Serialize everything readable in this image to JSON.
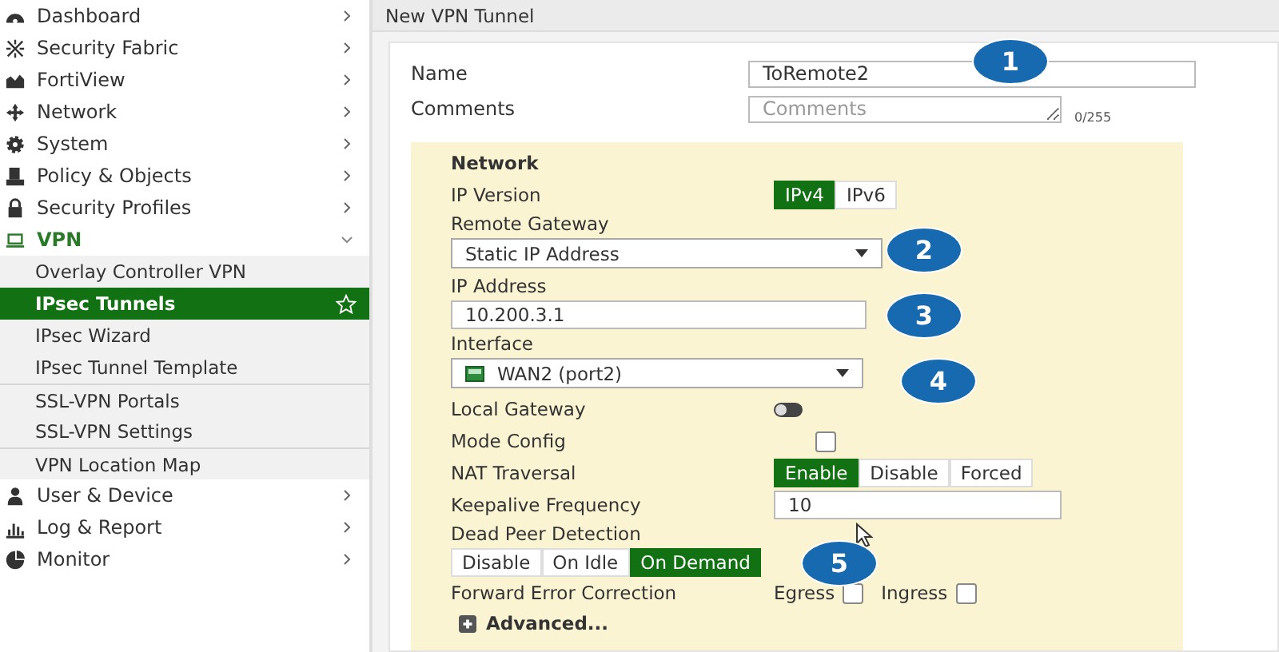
{
  "sidebar": {
    "items": [
      {
        "label": "Dashboard",
        "expanded": false
      },
      {
        "label": "Security Fabric",
        "expanded": false
      },
      {
        "label": "FortiView",
        "expanded": false
      },
      {
        "label": "Network",
        "expanded": false
      },
      {
        "label": "System",
        "expanded": false
      },
      {
        "label": "Policy & Objects",
        "expanded": false
      },
      {
        "label": "Security Profiles",
        "expanded": false
      },
      {
        "label": "VPN",
        "expanded": true,
        "children": [
          {
            "label": "Overlay Controller VPN",
            "selected": false
          },
          {
            "label": "IPsec Tunnels",
            "selected": true
          },
          {
            "label": "IPsec Wizard",
            "selected": false
          },
          {
            "label": "IPsec Tunnel Template",
            "selected": false
          },
          {
            "label": "SSL-VPN Portals",
            "selected": false
          },
          {
            "label": "SSL-VPN Settings",
            "selected": false
          },
          {
            "label": "VPN Location Map",
            "selected": false
          }
        ]
      },
      {
        "label": "User & Device",
        "expanded": false
      },
      {
        "label": "Log & Report",
        "expanded": false
      },
      {
        "label": "Monitor",
        "expanded": false
      }
    ]
  },
  "page_title": "New VPN Tunnel",
  "name": {
    "label": "Name",
    "value": "ToRemote2"
  },
  "comments": {
    "label": "Comments",
    "placeholder": "Comments",
    "counter": "0/255"
  },
  "network": {
    "heading": "Network",
    "rows": [
      {
        "kind": "segmented",
        "label": "IP Version",
        "options": [
          {
            "label": "IPv4",
            "selected": true
          },
          {
            "label": "IPv6",
            "selected": false
          }
        ]
      },
      {
        "kind": "select",
        "label": "Remote Gateway",
        "value": "Static IP Address"
      },
      {
        "kind": "text",
        "label": "IP Address",
        "value": "10.200.3.1"
      },
      {
        "kind": "select",
        "label": "Interface",
        "value": "WAN2 (port2)"
      },
      {
        "kind": "switch",
        "label": "Local Gateway",
        "on": false
      },
      {
        "kind": "checkbox",
        "label": "Mode Config",
        "checked": false
      },
      {
        "kind": "segmented",
        "label": "NAT Traversal",
        "options": [
          {
            "label": "Enable",
            "selected": true
          },
          {
            "label": "Disable",
            "selected": false
          },
          {
            "label": "Forced",
            "selected": false
          }
        ]
      },
      {
        "kind": "text",
        "label": "Keepalive Frequency",
        "value": "10"
      },
      {
        "kind": "segmented",
        "label": "Dead Peer Detection",
        "options": [
          {
            "label": "Disable",
            "selected": false
          },
          {
            "label": "On Idle",
            "selected": false
          },
          {
            "label": "On Demand",
            "selected": true
          }
        ]
      },
      {
        "kind": "checkbox-group",
        "label": "Forward Error Correction",
        "options": [
          {
            "label": "Egress",
            "checked": false
          },
          {
            "label": "Ingress",
            "checked": false
          }
        ]
      }
    ],
    "advanced": {
      "label": "Advanced..."
    }
  },
  "callouts": [
    "1",
    "2",
    "3",
    "4",
    "5"
  ]
}
